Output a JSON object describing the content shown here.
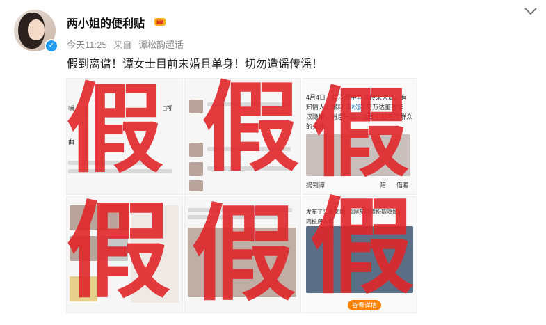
{
  "post": {
    "username": "两小姐的便利贴",
    "time": "今天11:25",
    "source_prefix": "来自",
    "source": "谭松韵超话",
    "text": "假到离谱！谭女士目前未婚且单身！切勿造谣传谣！"
  },
  "icons": {
    "verified": "verified-badge-icon",
    "crown": "crown-icon",
    "more": "chevron-down-icon"
  },
  "stamp": {
    "char": "假"
  },
  "thumbs": {
    "t1_a": "哺",
    "t1_b": "□视",
    "t1_c": "曲",
    "t3_a": "4月4日，娱乐圈中再次传来大瓜，有",
    "t3_b": "知情人士爆料",
    "t3_c": "谭松韵",
    "t3_d": "与万达董事华",
    "t3_e": "汉隐婚，消息一出，立即引起吃瓜群众",
    "t3_f": "的关注。",
    "t3_g": "提到谭",
    "t3_h": "陪",
    "t3_i": "借着",
    "t6_a": "发布了头条文章：《网友称谭松韵隐婚》",
    "t6_b": "内投资入华",
    "t6_c": "查看详情"
  },
  "colors": {
    "stamp_red": "#e0262a",
    "link_blue": "#1f6fb2",
    "verified_blue": "#1f9cf0"
  }
}
